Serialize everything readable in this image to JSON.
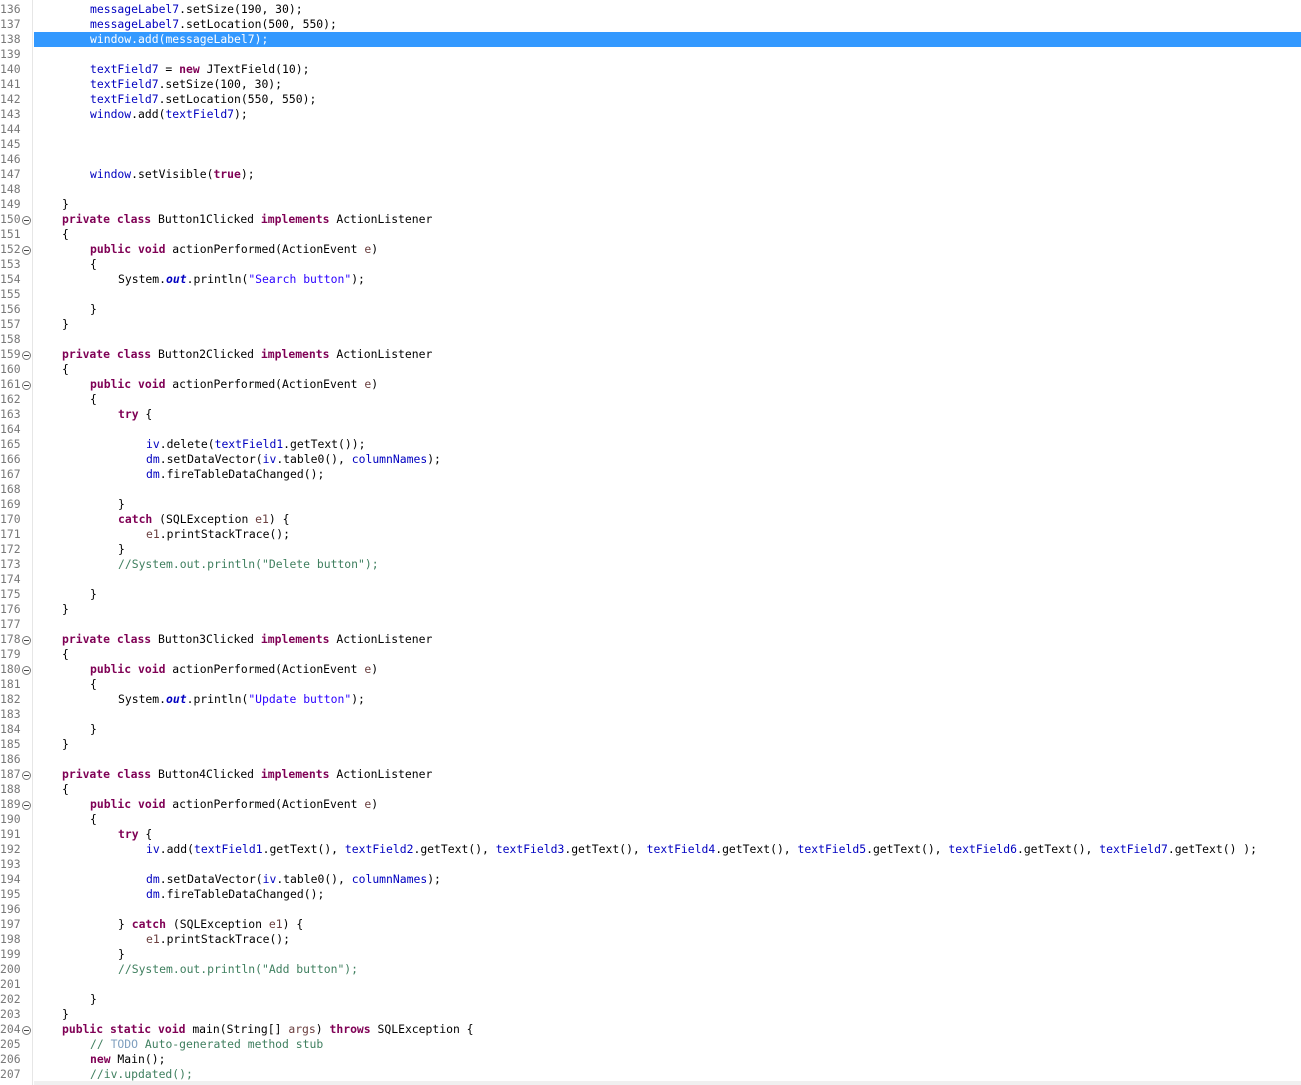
{
  "editor": {
    "highlighted_line": "138",
    "lines": [
      {
        "n": "136",
        "fold": false,
        "indent": 8,
        "t": [
          [
            "messageLabel7",
            "fld"
          ],
          [
            ".setSize(190, 30);",
            ""
          ]
        ]
      },
      {
        "n": "137",
        "fold": false,
        "indent": 8,
        "t": [
          [
            "messageLabel7",
            "fld"
          ],
          [
            ".setLocation(500, 550);",
            ""
          ]
        ]
      },
      {
        "n": "138",
        "fold": false,
        "indent": 8,
        "t": [
          [
            "window",
            "fld"
          ],
          [
            ".add(",
            ""
          ],
          [
            "messageLabel7",
            "fld"
          ],
          [
            ");",
            ""
          ]
        ]
      },
      {
        "n": "139",
        "fold": false,
        "indent": 0,
        "t": []
      },
      {
        "n": "140",
        "fold": false,
        "indent": 8,
        "t": [
          [
            "textField7",
            "fld"
          ],
          [
            " = ",
            ""
          ],
          [
            "new",
            "kw"
          ],
          [
            " JTextField(10);",
            ""
          ]
        ]
      },
      {
        "n": "141",
        "fold": false,
        "indent": 8,
        "t": [
          [
            "textField7",
            "fld"
          ],
          [
            ".setSize(100, 30);",
            ""
          ]
        ]
      },
      {
        "n": "142",
        "fold": false,
        "indent": 8,
        "t": [
          [
            "textField7",
            "fld"
          ],
          [
            ".setLocation(550, 550);",
            ""
          ]
        ]
      },
      {
        "n": "143",
        "fold": false,
        "indent": 8,
        "t": [
          [
            "window",
            "fld"
          ],
          [
            ".add(",
            ""
          ],
          [
            "textField7",
            "fld"
          ],
          [
            ");",
            ""
          ]
        ]
      },
      {
        "n": "144",
        "fold": false,
        "indent": 0,
        "t": []
      },
      {
        "n": "145",
        "fold": false,
        "indent": 0,
        "t": []
      },
      {
        "n": "146",
        "fold": false,
        "indent": 0,
        "t": []
      },
      {
        "n": "147",
        "fold": false,
        "indent": 8,
        "t": [
          [
            "window",
            "fld"
          ],
          [
            ".setVisible(",
            ""
          ],
          [
            "true",
            "kw"
          ],
          [
            ");",
            ""
          ]
        ]
      },
      {
        "n": "148",
        "fold": false,
        "indent": 0,
        "t": []
      },
      {
        "n": "149",
        "fold": false,
        "indent": 4,
        "t": [
          [
            "}",
            ""
          ]
        ]
      },
      {
        "n": "150",
        "fold": true,
        "indent": 4,
        "t": [
          [
            "private",
            "kw"
          ],
          [
            " ",
            ""
          ],
          [
            "class",
            "kw"
          ],
          [
            " Button1Clicked ",
            ""
          ],
          [
            "implements",
            "kw"
          ],
          [
            " ActionListener",
            ""
          ]
        ]
      },
      {
        "n": "151",
        "fold": false,
        "indent": 4,
        "t": [
          [
            "{",
            ""
          ]
        ]
      },
      {
        "n": "152",
        "fold": true,
        "indent": 8,
        "t": [
          [
            "public",
            "kw"
          ],
          [
            " ",
            ""
          ],
          [
            "void",
            "kw"
          ],
          [
            " actionPerformed(ActionEvent ",
            ""
          ],
          [
            "e",
            "par"
          ],
          [
            ")",
            ""
          ]
        ]
      },
      {
        "n": "153",
        "fold": false,
        "indent": 8,
        "t": [
          [
            "{",
            ""
          ]
        ]
      },
      {
        "n": "154",
        "fold": false,
        "indent": 12,
        "t": [
          [
            "System.",
            ""
          ],
          [
            "out",
            "stat"
          ],
          [
            ".println(",
            ""
          ],
          [
            "\"Search button\"",
            "str"
          ],
          [
            ");",
            ""
          ]
        ]
      },
      {
        "n": "155",
        "fold": false,
        "indent": 0,
        "t": []
      },
      {
        "n": "156",
        "fold": false,
        "indent": 8,
        "t": [
          [
            "}",
            ""
          ]
        ]
      },
      {
        "n": "157",
        "fold": false,
        "indent": 4,
        "t": [
          [
            "}",
            ""
          ]
        ]
      },
      {
        "n": "158",
        "fold": false,
        "indent": 0,
        "t": []
      },
      {
        "n": "159",
        "fold": true,
        "indent": 4,
        "t": [
          [
            "private",
            "kw"
          ],
          [
            " ",
            ""
          ],
          [
            "class",
            "kw"
          ],
          [
            " Button2Clicked ",
            ""
          ],
          [
            "implements",
            "kw"
          ],
          [
            " ActionListener",
            ""
          ]
        ]
      },
      {
        "n": "160",
        "fold": false,
        "indent": 4,
        "t": [
          [
            "{",
            ""
          ]
        ]
      },
      {
        "n": "161",
        "fold": true,
        "indent": 8,
        "t": [
          [
            "public",
            "kw"
          ],
          [
            " ",
            ""
          ],
          [
            "void",
            "kw"
          ],
          [
            " actionPerformed(ActionEvent ",
            ""
          ],
          [
            "e",
            "par"
          ],
          [
            ")",
            ""
          ]
        ]
      },
      {
        "n": "162",
        "fold": false,
        "indent": 8,
        "t": [
          [
            "{",
            ""
          ]
        ]
      },
      {
        "n": "163",
        "fold": false,
        "indent": 12,
        "t": [
          [
            "try",
            "kw"
          ],
          [
            " {",
            ""
          ]
        ]
      },
      {
        "n": "164",
        "fold": false,
        "indent": 0,
        "t": []
      },
      {
        "n": "165",
        "fold": false,
        "indent": 16,
        "t": [
          [
            "iv",
            "fld"
          ],
          [
            ".delete(",
            ""
          ],
          [
            "textField1",
            "fld"
          ],
          [
            ".getText());",
            ""
          ]
        ]
      },
      {
        "n": "166",
        "fold": false,
        "indent": 16,
        "t": [
          [
            "dm",
            "fld"
          ],
          [
            ".setDataVector(",
            ""
          ],
          [
            "iv",
            "fld"
          ],
          [
            ".table0(), ",
            ""
          ],
          [
            "columnNames",
            "fld"
          ],
          [
            ");",
            ""
          ]
        ]
      },
      {
        "n": "167",
        "fold": false,
        "indent": 16,
        "t": [
          [
            "dm",
            "fld"
          ],
          [
            ".fireTableDataChanged();",
            ""
          ]
        ]
      },
      {
        "n": "168",
        "fold": false,
        "indent": 0,
        "t": []
      },
      {
        "n": "169",
        "fold": false,
        "indent": 12,
        "t": [
          [
            "}",
            ""
          ]
        ]
      },
      {
        "n": "170",
        "fold": false,
        "indent": 12,
        "t": [
          [
            "catch",
            "kw"
          ],
          [
            " (SQLException ",
            ""
          ],
          [
            "e1",
            "par"
          ],
          [
            ") {",
            ""
          ]
        ]
      },
      {
        "n": "171",
        "fold": false,
        "indent": 16,
        "t": [
          [
            "e1",
            "par"
          ],
          [
            ".printStackTrace();",
            ""
          ]
        ]
      },
      {
        "n": "172",
        "fold": false,
        "indent": 12,
        "t": [
          [
            "}",
            ""
          ]
        ]
      },
      {
        "n": "173",
        "fold": false,
        "indent": 12,
        "t": [
          [
            "//System.out.println(\"Delete button\");",
            "cm"
          ]
        ]
      },
      {
        "n": "174",
        "fold": false,
        "indent": 0,
        "t": []
      },
      {
        "n": "175",
        "fold": false,
        "indent": 8,
        "t": [
          [
            "}",
            ""
          ]
        ]
      },
      {
        "n": "176",
        "fold": false,
        "indent": 4,
        "t": [
          [
            "}",
            ""
          ]
        ]
      },
      {
        "n": "177",
        "fold": false,
        "indent": 0,
        "t": []
      },
      {
        "n": "178",
        "fold": true,
        "indent": 4,
        "t": [
          [
            "private",
            "kw"
          ],
          [
            " ",
            ""
          ],
          [
            "class",
            "kw"
          ],
          [
            " Button3Clicked ",
            ""
          ],
          [
            "implements",
            "kw"
          ],
          [
            " ActionListener",
            ""
          ]
        ]
      },
      {
        "n": "179",
        "fold": false,
        "indent": 4,
        "t": [
          [
            "{",
            ""
          ]
        ]
      },
      {
        "n": "180",
        "fold": true,
        "indent": 8,
        "t": [
          [
            "public",
            "kw"
          ],
          [
            " ",
            ""
          ],
          [
            "void",
            "kw"
          ],
          [
            " actionPerformed(ActionEvent ",
            ""
          ],
          [
            "e",
            "par"
          ],
          [
            ")",
            ""
          ]
        ]
      },
      {
        "n": "181",
        "fold": false,
        "indent": 8,
        "t": [
          [
            "{",
            ""
          ]
        ]
      },
      {
        "n": "182",
        "fold": false,
        "indent": 12,
        "t": [
          [
            "System.",
            ""
          ],
          [
            "out",
            "stat"
          ],
          [
            ".println(",
            ""
          ],
          [
            "\"Update button\"",
            "str"
          ],
          [
            ");",
            ""
          ]
        ]
      },
      {
        "n": "183",
        "fold": false,
        "indent": 0,
        "t": []
      },
      {
        "n": "184",
        "fold": false,
        "indent": 8,
        "t": [
          [
            "}",
            ""
          ]
        ]
      },
      {
        "n": "185",
        "fold": false,
        "indent": 4,
        "t": [
          [
            "}",
            ""
          ]
        ]
      },
      {
        "n": "186",
        "fold": false,
        "indent": 0,
        "t": []
      },
      {
        "n": "187",
        "fold": true,
        "indent": 4,
        "t": [
          [
            "private",
            "kw"
          ],
          [
            " ",
            ""
          ],
          [
            "class",
            "kw"
          ],
          [
            " Button4Clicked ",
            ""
          ],
          [
            "implements",
            "kw"
          ],
          [
            " ActionListener",
            ""
          ]
        ]
      },
      {
        "n": "188",
        "fold": false,
        "indent": 4,
        "t": [
          [
            "{",
            ""
          ]
        ]
      },
      {
        "n": "189",
        "fold": true,
        "indent": 8,
        "t": [
          [
            "public",
            "kw"
          ],
          [
            " ",
            ""
          ],
          [
            "void",
            "kw"
          ],
          [
            " actionPerformed(ActionEvent ",
            ""
          ],
          [
            "e",
            "par"
          ],
          [
            ")",
            ""
          ]
        ]
      },
      {
        "n": "190",
        "fold": false,
        "indent": 8,
        "t": [
          [
            "{",
            ""
          ]
        ]
      },
      {
        "n": "191",
        "fold": false,
        "indent": 12,
        "t": [
          [
            "try",
            "kw"
          ],
          [
            " {",
            ""
          ]
        ]
      },
      {
        "n": "192",
        "fold": false,
        "indent": 16,
        "t": [
          [
            "iv",
            "fld"
          ],
          [
            ".add(",
            ""
          ],
          [
            "textField1",
            "fld"
          ],
          [
            ".getText(), ",
            ""
          ],
          [
            "textField2",
            "fld"
          ],
          [
            ".getText(), ",
            ""
          ],
          [
            "textField3",
            "fld"
          ],
          [
            ".getText(), ",
            ""
          ],
          [
            "textField4",
            "fld"
          ],
          [
            ".getText(), ",
            ""
          ],
          [
            "textField5",
            "fld"
          ],
          [
            ".getText(), ",
            ""
          ],
          [
            "textField6",
            "fld"
          ],
          [
            ".getText(), ",
            ""
          ],
          [
            "textField7",
            "fld"
          ],
          [
            ".getText() );",
            ""
          ]
        ]
      },
      {
        "n": "193",
        "fold": false,
        "indent": 0,
        "t": []
      },
      {
        "n": "194",
        "fold": false,
        "indent": 16,
        "t": [
          [
            "dm",
            "fld"
          ],
          [
            ".setDataVector(",
            ""
          ],
          [
            "iv",
            "fld"
          ],
          [
            ".table0(), ",
            ""
          ],
          [
            "columnNames",
            "fld"
          ],
          [
            ");",
            ""
          ]
        ]
      },
      {
        "n": "195",
        "fold": false,
        "indent": 16,
        "t": [
          [
            "dm",
            "fld"
          ],
          [
            ".fireTableDataChanged();",
            ""
          ]
        ]
      },
      {
        "n": "196",
        "fold": false,
        "indent": 0,
        "t": []
      },
      {
        "n": "197",
        "fold": false,
        "indent": 12,
        "t": [
          [
            "} ",
            ""
          ],
          [
            "catch",
            "kw"
          ],
          [
            " (SQLException ",
            ""
          ],
          [
            "e1",
            "par"
          ],
          [
            ") {",
            ""
          ]
        ]
      },
      {
        "n": "198",
        "fold": false,
        "indent": 16,
        "t": [
          [
            "e1",
            "par"
          ],
          [
            ".printStackTrace();",
            ""
          ]
        ]
      },
      {
        "n": "199",
        "fold": false,
        "indent": 12,
        "t": [
          [
            "}",
            ""
          ]
        ]
      },
      {
        "n": "200",
        "fold": false,
        "indent": 12,
        "t": [
          [
            "//System.out.println(\"Add button\");",
            "cm"
          ]
        ]
      },
      {
        "n": "201",
        "fold": false,
        "indent": 0,
        "t": []
      },
      {
        "n": "202",
        "fold": false,
        "indent": 8,
        "t": [
          [
            "}",
            ""
          ]
        ]
      },
      {
        "n": "203",
        "fold": false,
        "indent": 4,
        "t": [
          [
            "}",
            ""
          ]
        ]
      },
      {
        "n": "204",
        "fold": true,
        "indent": 4,
        "t": [
          [
            "public",
            "kw"
          ],
          [
            " ",
            ""
          ],
          [
            "static",
            "kw"
          ],
          [
            " ",
            ""
          ],
          [
            "void",
            "kw"
          ],
          [
            " main(String[] ",
            ""
          ],
          [
            "args",
            "par"
          ],
          [
            ") ",
            ""
          ],
          [
            "throws",
            "kw"
          ],
          [
            " SQLException {",
            ""
          ]
        ]
      },
      {
        "n": "205",
        "fold": false,
        "indent": 8,
        "t": [
          [
            "// ",
            "cm"
          ],
          [
            "TODO",
            "todo"
          ],
          [
            " Auto-generated method stub",
            "cm"
          ]
        ]
      },
      {
        "n": "206",
        "fold": false,
        "indent": 8,
        "t": [
          [
            "new",
            "kw"
          ],
          [
            " Main();",
            ""
          ]
        ]
      },
      {
        "n": "207",
        "fold": false,
        "indent": 8,
        "t": [
          [
            "//iv.updated();",
            "cm"
          ]
        ]
      }
    ]
  }
}
